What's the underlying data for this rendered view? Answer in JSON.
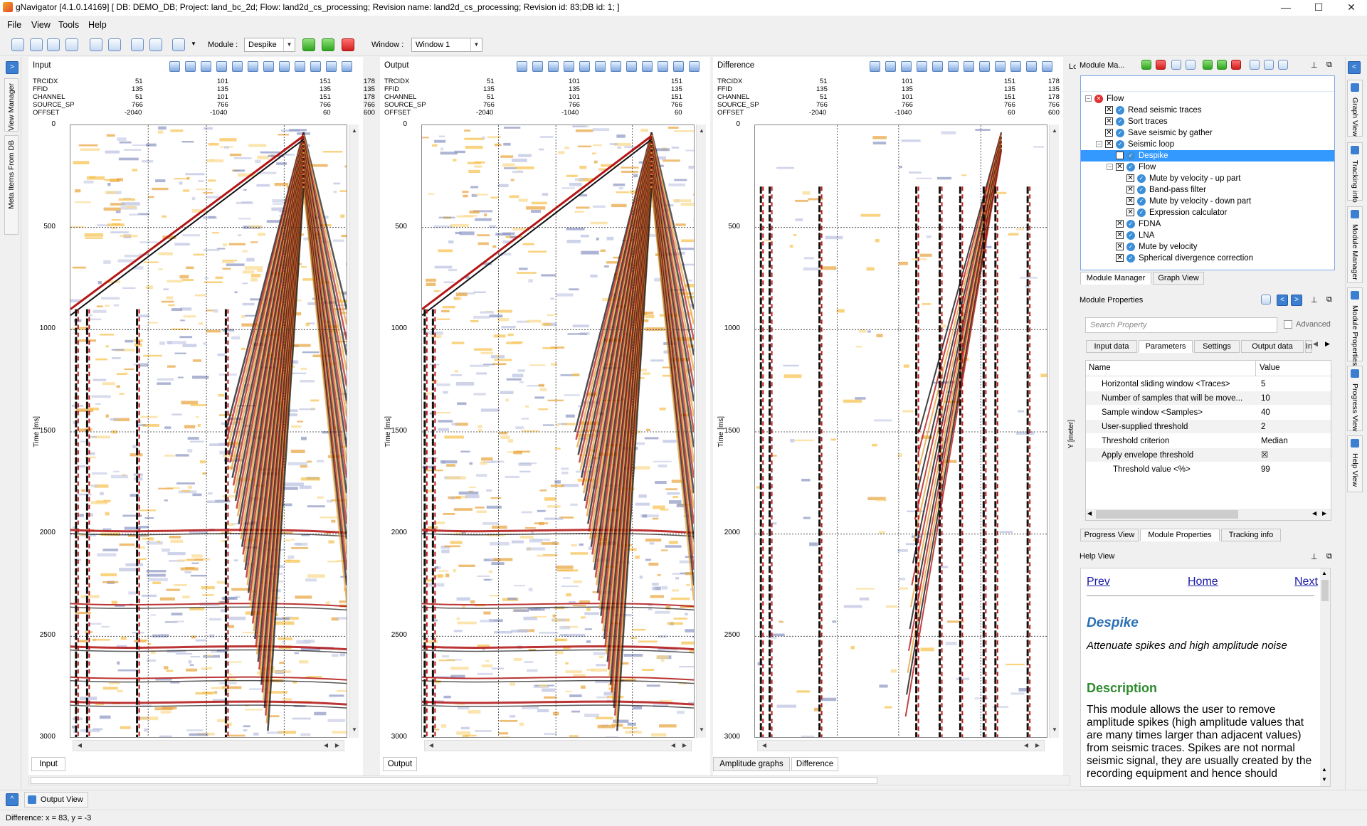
{
  "window": {
    "title": "gNavigator [4.1.0.14169] [ DB: DEMO_DB; Project: land_bc_2d; Flow: land2d_cs_processing; Revision name: land2d_cs_processing; Revision id: 83;DB id: 1; ]",
    "minimize": "—",
    "maximize": "☐",
    "close": "✕"
  },
  "menu": [
    "File",
    "View",
    "Tools",
    "Help"
  ],
  "toolbar": {
    "module_label": "Module :",
    "module_value": "Despike",
    "window_label": "Window :",
    "window_value": "Window 1"
  },
  "left_strip": {
    "view_manager": "View Manager",
    "meta_items": "Meta Items From DB"
  },
  "panels": [
    {
      "title": "Input",
      "tab": "Input",
      "headers": [
        [
          "TRCIDX",
          "51",
          "101",
          "151",
          "178"
        ],
        [
          "FFID",
          "135",
          "135",
          "135",
          "135"
        ],
        [
          "CHANNEL",
          "51",
          "101",
          "151",
          "178"
        ],
        [
          "SOURCE_SP",
          "766",
          "766",
          "766",
          "766"
        ],
        [
          "OFFSET",
          "-2040",
          "-1040",
          "60",
          "600"
        ]
      ]
    },
    {
      "title": "Output",
      "tab": "Output",
      "headers": [
        [
          "TRCIDX",
          "51",
          "101",
          "151",
          "178"
        ],
        [
          "FFID",
          "135",
          "135",
          "135",
          "135"
        ],
        [
          "CHANNEL",
          "51",
          "101",
          "151",
          "178"
        ],
        [
          "SOURCE_SP",
          "766",
          "766",
          "766",
          "766"
        ],
        [
          "OFFSET",
          "-2040",
          "-1040",
          "60",
          "600"
        ]
      ]
    },
    {
      "title": "Difference",
      "tab": "Difference",
      "tab2": "Amplitude graphs",
      "headers": [
        [
          "TRCIDX",
          "51",
          "101",
          "151",
          "178"
        ],
        [
          "FFID",
          "135",
          "135",
          "135",
          "135"
        ],
        [
          "CHANNEL",
          "51",
          "101",
          "151",
          "178"
        ],
        [
          "SOURCE_SP",
          "766",
          "766",
          "766",
          "766"
        ],
        [
          "OFFSET",
          "-2040",
          "-1040",
          "60",
          "600"
        ]
      ]
    }
  ],
  "time_axis": {
    "title": "Time [ms]",
    "ticks": [
      "0",
      "500",
      "1000",
      "1500",
      "2000",
      "2500",
      "3000"
    ]
  },
  "partial_label": "Lo",
  "yaxis_partial": "Y [meter]",
  "module_manager": {
    "title": "Module Ma...",
    "tree": [
      {
        "label": "Flow",
        "level": 0,
        "status": "error",
        "expander": "−"
      },
      {
        "label": "Read seismic traces",
        "level": 1,
        "status": "ok"
      },
      {
        "label": "Sort traces",
        "level": 1,
        "status": "ok"
      },
      {
        "label": "Save seismic by gather",
        "level": 1,
        "status": "ok"
      },
      {
        "label": "Seismic loop",
        "level": 1,
        "status": "ok",
        "expander": "−"
      },
      {
        "label": "Despike",
        "level": 2,
        "status": "ok",
        "selected": true
      },
      {
        "label": "Flow",
        "level": 2,
        "status": "ok",
        "expander": "−"
      },
      {
        "label": "Mute by velocity - up part",
        "level": 3,
        "status": "ok"
      },
      {
        "label": "Band-pass filter",
        "level": 3,
        "status": "ok"
      },
      {
        "label": "Mute by velocity - down part",
        "level": 3,
        "status": "ok"
      },
      {
        "label": "Expression calculator",
        "level": 3,
        "status": "ok"
      },
      {
        "label": "FDNA",
        "level": 2,
        "status": "ok"
      },
      {
        "label": "LNA",
        "level": 2,
        "status": "ok"
      },
      {
        "label": "Mute by velocity",
        "level": 2,
        "status": "ok"
      },
      {
        "label": "Spherical divergence correction",
        "level": 2,
        "status": "ok"
      }
    ],
    "tabs": [
      "Module Manager",
      "Graph View"
    ]
  },
  "module_properties": {
    "title": "Module Properties",
    "search_placeholder": "Search Property",
    "advanced": "Advanced",
    "tabs": [
      "Input data",
      "Parameters",
      "Settings",
      "Output data",
      "In"
    ],
    "col_name": "Name",
    "col_value": "Value",
    "rows": [
      {
        "name": "Horizontal sliding window <Traces>",
        "value": "5",
        "indent": false
      },
      {
        "name": "Number of samples that will be move...",
        "value": "10",
        "indent": false
      },
      {
        "name": "Sample window <Samples>",
        "value": "40",
        "indent": false
      },
      {
        "name": "User-supplied threshold",
        "value": "2",
        "indent": false
      },
      {
        "name": "Threshold criterion",
        "value": "Median",
        "indent": false
      },
      {
        "name": "Apply envelope threshold",
        "value": "☒",
        "indent": false
      },
      {
        "name": "Threshold value <%>",
        "value": "99",
        "indent": true
      }
    ],
    "bottom_tabs": [
      "Progress View",
      "Module Properties",
      "Tracking info"
    ]
  },
  "help": {
    "title": "Help View",
    "prev": "Prev",
    "home": "Home",
    "next": "Next",
    "heading": "Despike",
    "subtitle": "Attenuate spikes and high amplitude noise",
    "section": "Description",
    "body": "This module allows the user to remove amplitude spikes (high amplitude values that are many times larger than adjacent values) from seismic traces. Spikes are not normal seismic signal, they are usually created by the recording equipment and hence should"
  },
  "right_strip": [
    "Graph View",
    "Tracking info",
    "Module Manager",
    "Module Properties",
    "Progress View",
    "Help View"
  ],
  "bottom": {
    "output_view": "Output View"
  },
  "status": "Difference:  x = 83, y = -3",
  "colors": {
    "accent": "#3c7fd1",
    "selection": "#3399ff",
    "heading_blue": "#2a6fb5",
    "heading_green": "#2e8b2e"
  }
}
